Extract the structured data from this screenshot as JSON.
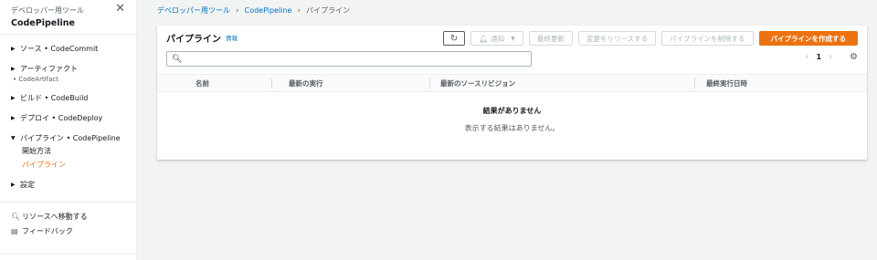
{
  "sidebar": {
    "service_label": "デベロッパー用ツール",
    "title": "CodePipeline",
    "groups": [
      {
        "label": "ソース • CodeCommit",
        "expanded": false
      },
      {
        "label": "アーティファクト",
        "sub": "• CodeArtifact",
        "expanded": false
      },
      {
        "label": "ビルド • CodeBuild",
        "expanded": false
      },
      {
        "label": "デプロイ • CodeDeploy",
        "expanded": false
      },
      {
        "label": "パイプライン • CodePipeline",
        "expanded": true,
        "children": [
          {
            "label": "開始方法",
            "active": false
          },
          {
            "label": "パイプライン",
            "active": true
          }
        ]
      },
      {
        "label": "設定",
        "expanded": false
      }
    ],
    "tools": [
      {
        "label": "リソースへ移動する",
        "icon": "search-icon"
      },
      {
        "label": "フィードバック",
        "icon": "feedback-icon"
      }
    ]
  },
  "breadcrumb": {
    "items": [
      "デベロッパー用ツール",
      "CodePipeline"
    ],
    "current": "パイプライン"
  },
  "panel": {
    "title": "パイプライン",
    "info": "情報",
    "buttons": {
      "notify": "通知",
      "history": "最終更新",
      "release": "変更をリリースする",
      "delete": "パイプラインを削除する",
      "create": "パイプラインを作成する"
    },
    "search": {
      "placeholder": "",
      "value": ""
    },
    "pager": {
      "page": "1"
    },
    "columns": [
      "名前",
      "最新の実行",
      "最新のソースリビジョン",
      "最終実行日時"
    ],
    "empty_title": "結果がありません",
    "empty_message": "表示する結果はありません。"
  },
  "colors": {
    "accent": "#ec7211",
    "link": "#0073bb",
    "background": "#f2f3f3"
  }
}
